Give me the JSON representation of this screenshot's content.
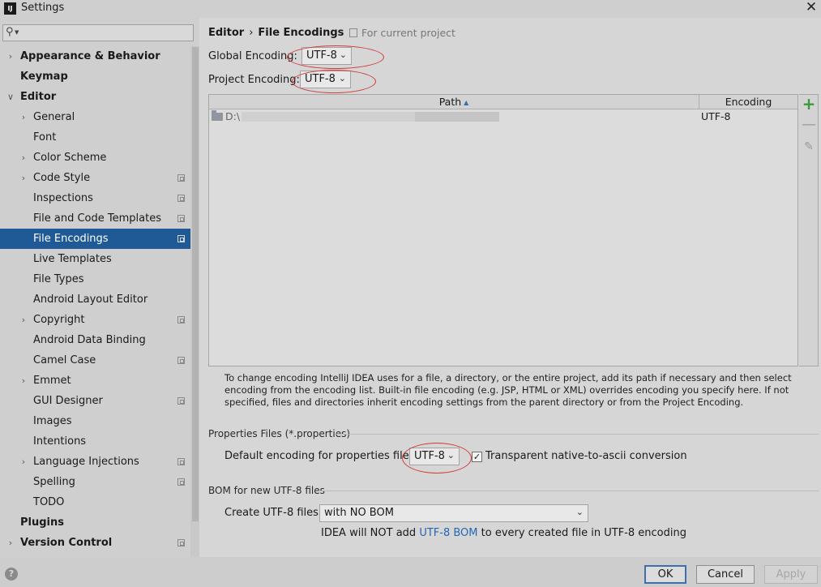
{
  "window": {
    "title": "Settings",
    "app_icon": "IJ",
    "close_glyph": "✕"
  },
  "search": {
    "placeholder": "",
    "value": ""
  },
  "sidebar": {
    "items": [
      {
        "label": "Appearance & Behavior",
        "expandable": true,
        "bold": true
      },
      {
        "label": "Keymap",
        "bold": true
      },
      {
        "label": "Editor",
        "expandable": true,
        "expanded": true,
        "bold": true
      },
      {
        "label": "General",
        "expandable": true
      },
      {
        "label": "Font"
      },
      {
        "label": "Color Scheme",
        "expandable": true
      },
      {
        "label": "Code Style",
        "expandable": true,
        "project": true
      },
      {
        "label": "Inspections",
        "project": true
      },
      {
        "label": "File and Code Templates",
        "project": true
      },
      {
        "label": "File Encodings",
        "project": true,
        "selected": true
      },
      {
        "label": "Live Templates"
      },
      {
        "label": "File Types"
      },
      {
        "label": "Android Layout Editor"
      },
      {
        "label": "Copyright",
        "expandable": true,
        "project": true
      },
      {
        "label": "Android Data Binding"
      },
      {
        "label": "Camel Case",
        "project": true
      },
      {
        "label": "Emmet",
        "expandable": true
      },
      {
        "label": "GUI Designer",
        "project": true
      },
      {
        "label": "Images"
      },
      {
        "label": "Intentions"
      },
      {
        "label": "Language Injections",
        "expandable": true,
        "project": true
      },
      {
        "label": "Spelling",
        "project": true
      },
      {
        "label": "TODO"
      },
      {
        "label": "Plugins",
        "bold": true
      },
      {
        "label": "Version Control",
        "expandable": true,
        "project": true,
        "bold": true
      }
    ]
  },
  "header": {
    "section": "Editor",
    "separator": "›",
    "page": "File Encodings",
    "scope": "For current project"
  },
  "encodings": {
    "global_label": "Global Encoding:",
    "global_value": "UTF-8",
    "project_label": "Project Encoding:",
    "project_value": "UTF-8"
  },
  "table": {
    "columns": [
      "Path",
      "Encoding"
    ],
    "sort_glyph": "▲",
    "rows": [
      {
        "path": "D:\\",
        "encoding": "UTF-8"
      }
    ]
  },
  "tools": {
    "add": "+",
    "remove": "—",
    "edit": "✎"
  },
  "note": "To change encoding IntelliJ IDEA uses for a file, a directory, or the entire project, add its path if necessary and then select encoding from the encoding list. Built-in file encoding (e.g. JSP, HTML or XML) overrides encoding you specify here. If not specified, files and directories inherit encoding settings from the parent directory or from the Project Encoding.",
  "properties": {
    "group_title": "Properties Files (*.properties)",
    "default_label": "Default encoding for properties files:",
    "default_value": "UTF-8",
    "native_checked": true,
    "native_label": "Transparent native-to-ascii conversion"
  },
  "bom": {
    "group_title": "BOM for new UTF-8 files",
    "create_label": "Create UTF-8 files:",
    "create_value": "with NO BOM",
    "note_pre": "IDEA will NOT add ",
    "note_link": "UTF-8 BOM",
    "note_post": " to every created file in UTF-8 encoding"
  },
  "footer": {
    "ok": "OK",
    "cancel": "Cancel",
    "apply": "Apply",
    "help": "?"
  },
  "colors": {
    "selection": "#1f5a96",
    "link": "#2466b6",
    "annotation": "#d23a3a",
    "add": "#3c9a3c"
  }
}
